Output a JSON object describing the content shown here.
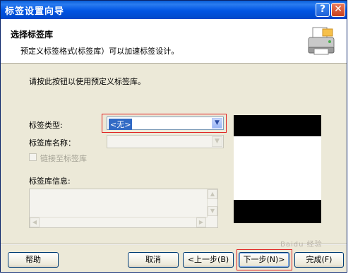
{
  "window": {
    "title": "标签设置向导",
    "help_glyph": "?",
    "close_glyph": "✕"
  },
  "header": {
    "title": "选择标签库",
    "subtitle": "预定义标签格式(标签库）可以加速标签设计。"
  },
  "body": {
    "instruction": "请按此按钮以使用预定义标签库。",
    "label_type": {
      "label": "标签类型:",
      "value": "<无>"
    },
    "library_name": {
      "label": "标签库名称：",
      "value": ""
    },
    "link_checkbox": {
      "label": "链接至标签库",
      "checked": false
    },
    "library_info": {
      "label": "标签库信息:"
    }
  },
  "buttons": {
    "help": "帮助",
    "cancel": "取消",
    "back": "<上一步(B)",
    "next": "下一步(N)>",
    "finish": "完成(F)"
  },
  "colors": {
    "accent": "#0054e3",
    "highlight": "#e02020",
    "dialog_bg": "#ece9d8"
  }
}
